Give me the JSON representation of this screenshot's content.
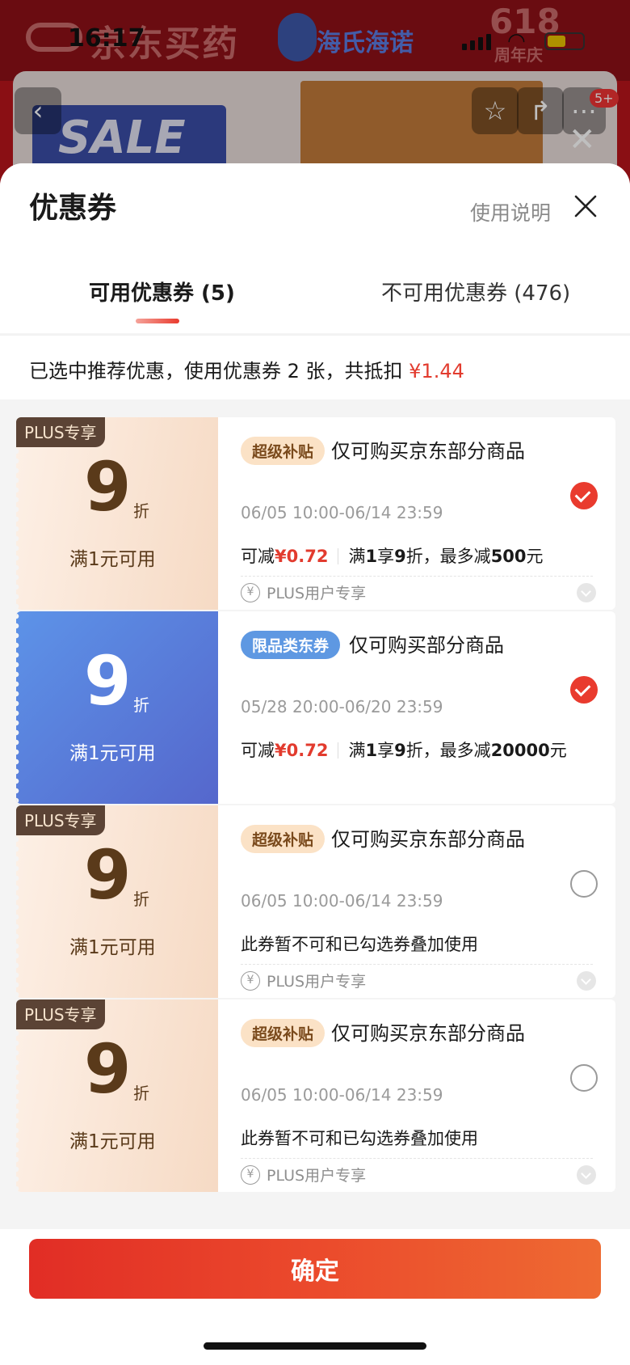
{
  "status_bar": {
    "time": "16:17"
  },
  "background": {
    "logo_text": "京东买药",
    "brand": "海氏海诺",
    "promo_number": "618",
    "promo_sub": "周年庆",
    "banner_text": "SALE",
    "badge": "5+"
  },
  "sheet": {
    "title": "优惠券",
    "help_link": "使用说明",
    "tabs": [
      {
        "label": "可用优惠券 (5)",
        "active": true
      },
      {
        "label": "不可用优惠券 (476)",
        "active": false
      }
    ],
    "summary": {
      "text": "已选中推荐优惠，使用优惠券 2 张，共抵扣 ",
      "amount": "¥1.44"
    }
  },
  "coupons": [
    {
      "type": "plus",
      "tag": "PLUS专享",
      "discount": "9",
      "unit": "折",
      "minimum": "满1元可用",
      "badge": "超级补贴",
      "title": "仅可购买京东部分商品",
      "date": "06/05 10:00-06/14 23:59",
      "reduce_label": "可减",
      "reduce_amount": "¥0.72",
      "rule_a": "满",
      "rule_b": "1",
      "rule_c": "享",
      "rule_d": "9",
      "rule_e": "折，最多减",
      "rule_f": "500",
      "rule_g": "元",
      "footer": "PLUS用户专享",
      "checked": true
    },
    {
      "type": "blue",
      "discount": "9",
      "unit": "折",
      "minimum": "满1元可用",
      "badge": "限品类东券",
      "title": "仅可购买部分商品",
      "date": "05/28 20:00-06/20 23:59",
      "reduce_label": "可减",
      "reduce_amount": "¥0.72",
      "rule_a": "满",
      "rule_b": "1",
      "rule_c": "享",
      "rule_d": "9",
      "rule_e": "折，最多减",
      "rule_f": "20000",
      "rule_g": "元",
      "checked": true
    },
    {
      "type": "plus",
      "tag": "PLUS专享",
      "discount": "9",
      "unit": "折",
      "minimum": "满1元可用",
      "badge": "超级补贴",
      "title": "仅可购买京东部分商品",
      "date": "06/05 10:00-06/14 23:59",
      "note": "此券暂不可和已勾选券叠加使用",
      "footer": "PLUS用户专享",
      "checked": false
    },
    {
      "type": "plus",
      "tag": "PLUS专享",
      "discount": "9",
      "unit": "折",
      "minimum": "满1元可用",
      "badge": "超级补贴",
      "title": "仅可购买京东部分商品",
      "date": "06/05 10:00-06/14 23:59",
      "note": "此券暂不可和已勾选券叠加使用",
      "footer": "PLUS用户专享",
      "checked": false
    }
  ],
  "yen_symbol": "¥",
  "confirm_button": "确定",
  "colors": {
    "accent_red": "#e93b2e",
    "plus_gold": "#5a3a1a",
    "blue_coupon": "#5567cc"
  }
}
